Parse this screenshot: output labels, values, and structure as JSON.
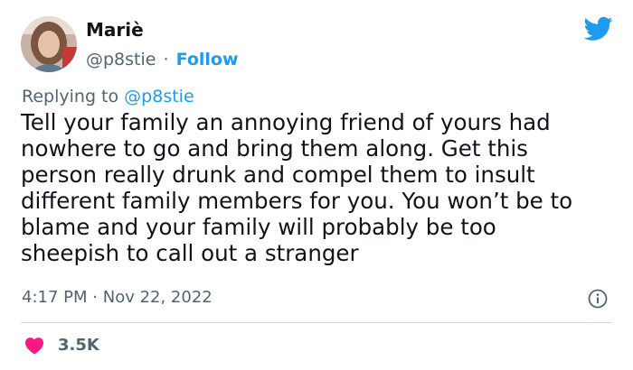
{
  "author": {
    "name": "Mariè",
    "handle": "@p8stie",
    "separator": "·",
    "follow_label": "Follow"
  },
  "reply": {
    "prefix": "Replying to",
    "handle": "@p8stie"
  },
  "tweet": {
    "text": "Tell your family an annoying friend of yours had\nnowhere to go and bring them along. Get this\nperson really drunk and compel them to insult\ndifferent family members for you. You won’t be to\nblame and your family will probably be too\nsheepish to call out a stranger",
    "time": "4:17 PM",
    "separator": "·",
    "date": "Nov 22, 2022"
  },
  "engagement": {
    "likes": "3.5K"
  },
  "icons": {
    "brand": "twitter-bird-icon",
    "info": "info-icon",
    "like": "heart-icon"
  },
  "colors": {
    "accent": "#1d9bf0",
    "like": "#f91880",
    "muted_text": "#536471",
    "text": "#0f1419",
    "divider": "#cfd9de"
  }
}
